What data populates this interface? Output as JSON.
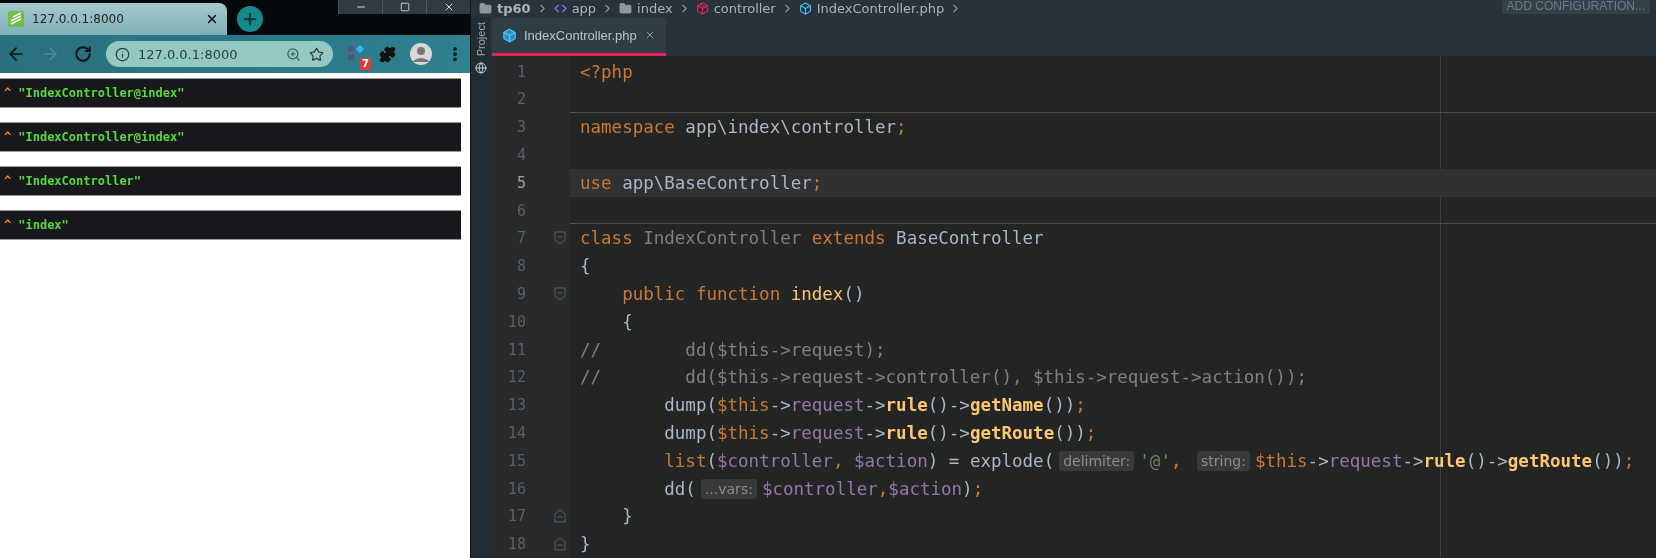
{
  "browser": {
    "tab": {
      "title": "127.0.0.1:8000",
      "selected": true
    },
    "address": "127.0.0.1:8000",
    "forward_disabled": true,
    "extension_badge": "7",
    "dumps": [
      {
        "caret": "^",
        "value": "\"IndexController@index\""
      },
      {
        "caret": "^",
        "value": "\"IndexController@index\""
      },
      {
        "caret": "^",
        "value": "\"IndexController\""
      },
      {
        "caret": "^",
        "value": "\"index\""
      }
    ]
  },
  "ide": {
    "breadcrumbs": [
      {
        "label": "tp60",
        "kind": "project"
      },
      {
        "label": "app",
        "kind": "module"
      },
      {
        "label": "index",
        "kind": "folder"
      },
      {
        "label": "controller",
        "kind": "package"
      },
      {
        "label": "IndexController.php",
        "kind": "file"
      }
    ],
    "run_config": "ADD CONFIGURATION...",
    "side_tab": "Project",
    "tabs": [
      {
        "label": "IndexController.php",
        "selected": true
      }
    ],
    "code_lines": [
      {
        "number": "1",
        "current": false,
        "fold_start": false,
        "fold_end": false,
        "separator": false,
        "tokens": [
          {
            "kind": "keyword",
            "text": "<?php"
          }
        ]
      },
      {
        "number": "2",
        "current": false,
        "fold_start": false,
        "fold_end": false,
        "separator": true
      },
      {
        "number": "3",
        "current": false,
        "fold_start": false,
        "fold_end": false,
        "separator": false,
        "tokens": [
          {
            "kind": "keyword",
            "text": "namespace "
          },
          {
            "kind": "plain",
            "text": "app\\index\\controller"
          },
          {
            "kind": "punct",
            "text": ";"
          }
        ]
      },
      {
        "number": "4",
        "current": false,
        "fold_start": false,
        "fold_end": false,
        "separator": false
      },
      {
        "number": "5",
        "current": true,
        "fold_start": false,
        "fold_end": false,
        "separator": false,
        "tokens": [
          {
            "kind": "keyword",
            "text": "use "
          },
          {
            "kind": "plain",
            "text": "app\\BaseController"
          },
          {
            "kind": "punct",
            "text": ";"
          }
        ]
      },
      {
        "number": "6",
        "current": false,
        "fold_start": false,
        "fold_end": false,
        "separator": true
      },
      {
        "number": "7",
        "current": false,
        "fold_start": true,
        "fold_end": false,
        "separator": false,
        "tokens": [
          {
            "kind": "keyword",
            "text": "class "
          },
          {
            "kind": "unused",
            "text": "IndexController"
          },
          {
            "kind": "keyword",
            "text": " extends "
          },
          {
            "kind": "plain",
            "text": "BaseController"
          }
        ]
      },
      {
        "number": "8",
        "current": false,
        "fold_start": false,
        "fold_end": false,
        "separator": false,
        "tokens": [
          {
            "kind": "plain",
            "text": "{"
          }
        ]
      },
      {
        "number": "9",
        "current": false,
        "fold_start": true,
        "fold_end": false,
        "separator": false,
        "tokens": [
          {
            "kind": "keyword",
            "text": "    public function "
          },
          {
            "kind": "function",
            "text": "index"
          },
          {
            "kind": "plain",
            "text": "()"
          }
        ]
      },
      {
        "number": "10",
        "current": false,
        "fold_start": false,
        "fold_end": false,
        "separator": false,
        "tokens": [
          {
            "kind": "plain",
            "text": "    {"
          }
        ]
      },
      {
        "number": "11",
        "current": false,
        "fold_start": false,
        "fold_end": false,
        "separator": false,
        "tokens": [
          {
            "kind": "comment",
            "text": "//        dd($this->request);"
          }
        ]
      },
      {
        "number": "12",
        "current": false,
        "fold_start": false,
        "fold_end": false,
        "separator": false,
        "tokens": [
          {
            "kind": "comment",
            "text": "//        dd($this->request->controller(), $this->request->action());"
          }
        ]
      },
      {
        "number": "13",
        "current": false,
        "fold_start": false,
        "fold_end": false,
        "separator": false,
        "tokens": [
          {
            "kind": "plain",
            "text": "        dump("
          },
          {
            "kind": "this",
            "text": "$this"
          },
          {
            "kind": "plain",
            "text": "->"
          },
          {
            "kind": "field",
            "text": "request"
          },
          {
            "kind": "plain",
            "text": "->"
          },
          {
            "kind": "call",
            "text": "rule"
          },
          {
            "kind": "plain",
            "text": "()->"
          },
          {
            "kind": "call",
            "text": "getName"
          },
          {
            "kind": "plain",
            "text": "())"
          },
          {
            "kind": "punct",
            "text": ";"
          }
        ]
      },
      {
        "number": "14",
        "current": false,
        "fold_start": false,
        "fold_end": false,
        "separator": false,
        "tokens": [
          {
            "kind": "plain",
            "text": "        dump("
          },
          {
            "kind": "this",
            "text": "$this"
          },
          {
            "kind": "plain",
            "text": "->"
          },
          {
            "kind": "field",
            "text": "request"
          },
          {
            "kind": "plain",
            "text": "->"
          },
          {
            "kind": "call",
            "text": "rule"
          },
          {
            "kind": "plain",
            "text": "()->"
          },
          {
            "kind": "call",
            "text": "getRoute"
          },
          {
            "kind": "plain",
            "text": "())"
          },
          {
            "kind": "punct",
            "text": ";"
          }
        ]
      },
      {
        "number": "15",
        "current": false,
        "fold_start": false,
        "fold_end": false,
        "separator": false,
        "tokens": [
          {
            "kind": "keyword",
            "text": "        list"
          },
          {
            "kind": "plain",
            "text": "("
          },
          {
            "kind": "variable",
            "text": "$controller"
          },
          {
            "kind": "punct",
            "text": ", "
          },
          {
            "kind": "variable",
            "text": "$action"
          },
          {
            "kind": "plain",
            "text": ") = explode("
          },
          {
            "kind": "hint",
            "text": "delimiter:"
          },
          {
            "kind": "string",
            "text": "'@'"
          },
          {
            "kind": "punct",
            "text": ", "
          },
          {
            "kind": "hint",
            "text": "string:"
          },
          {
            "kind": "this",
            "text": "$this"
          },
          {
            "kind": "plain",
            "text": "->"
          },
          {
            "kind": "field",
            "text": "request"
          },
          {
            "kind": "plain",
            "text": "->"
          },
          {
            "kind": "call",
            "text": "rule"
          },
          {
            "kind": "plain",
            "text": "()->"
          },
          {
            "kind": "call",
            "text": "getRoute"
          },
          {
            "kind": "plain",
            "text": "())"
          },
          {
            "kind": "punct",
            "text": ";"
          }
        ]
      },
      {
        "number": "16",
        "current": false,
        "fold_start": false,
        "fold_end": false,
        "separator": false,
        "tokens": [
          {
            "kind": "plain",
            "text": "        dd("
          },
          {
            "kind": "hint",
            "text": "...vars:"
          },
          {
            "kind": "variable",
            "text": "$controller"
          },
          {
            "kind": "punct",
            "text": ","
          },
          {
            "kind": "variable",
            "text": "$action"
          },
          {
            "kind": "plain",
            "text": ")"
          },
          {
            "kind": "punct",
            "text": ";"
          }
        ]
      },
      {
        "number": "17",
        "current": false,
        "fold_start": false,
        "fold_end": true,
        "separator": false,
        "tokens": [
          {
            "kind": "plain",
            "text": "    }"
          }
        ]
      },
      {
        "number": "18",
        "current": false,
        "fold_start": false,
        "fold_end": true,
        "separator": false,
        "tokens": [
          {
            "kind": "plain",
            "text": "}"
          }
        ]
      }
    ]
  }
}
